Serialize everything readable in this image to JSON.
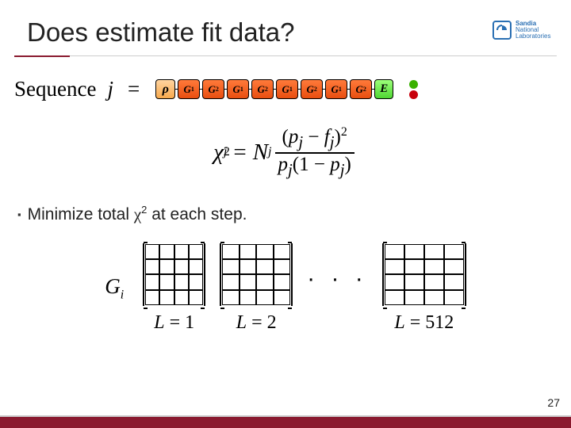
{
  "logo": {
    "name": "Sandia National Laboratories"
  },
  "title": "Does estimate fit data?",
  "sequence": {
    "label": "Sequence",
    "var": "j",
    "eq": "=",
    "gates": [
      "ρ",
      "G₁",
      "G₂",
      "G₁",
      "G₂",
      "G₁",
      "G₂",
      "G₁",
      "G₂",
      "E"
    ]
  },
  "chi_formula": {
    "lhs": "χ",
    "sup": "2",
    "sub": "j",
    "eq": "=",
    "N": "N",
    "Nsub": "j",
    "num": "(pⱼ − fⱼ)²",
    "den": "pⱼ(1 − pⱼ)"
  },
  "bullet": {
    "pre": "Minimize total ",
    "chi": "χ",
    "sup": "2",
    "post": " at each step."
  },
  "matrices": {
    "Gi": "G",
    "Gisub": "i",
    "grid": 4,
    "labels": [
      "L = 1",
      "L = 2",
      "L = 512"
    ],
    "ellipsis": "· · ·"
  },
  "page_number": "27"
}
